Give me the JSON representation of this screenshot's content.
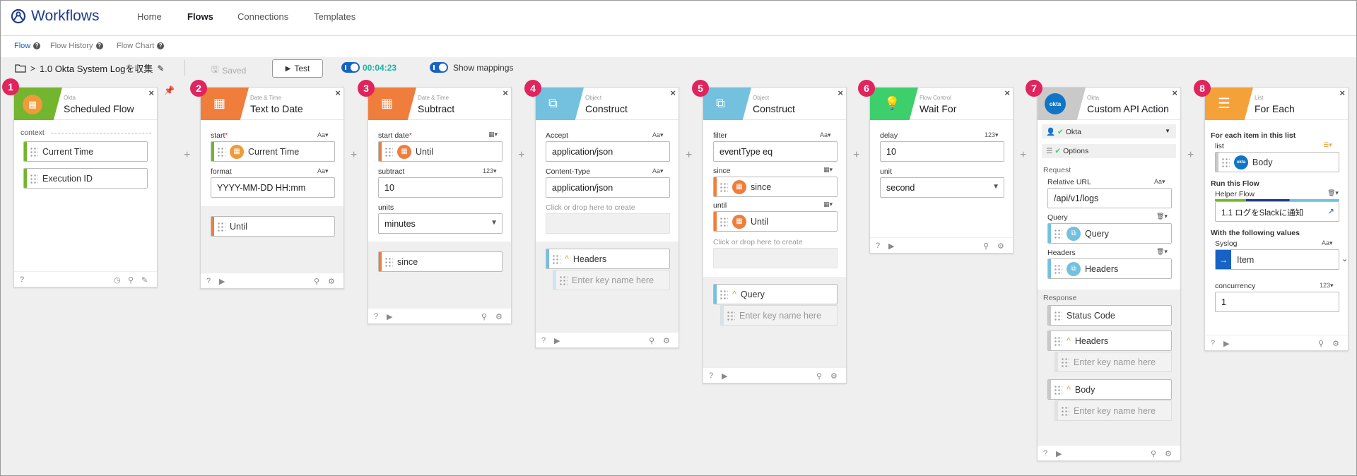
{
  "app": {
    "name": "Workflows"
  },
  "nav": {
    "home": "Home",
    "flows": "Flows",
    "connections": "Connections",
    "templates": "Templates"
  },
  "subnav": {
    "flow": "Flow",
    "history": "Flow History",
    "chart": "Flow Chart"
  },
  "toolbar": {
    "flow_name": "1.0 Okta System Logを収集",
    "saved": "Saved",
    "test": "Test",
    "timer": "00:04:23",
    "show_mappings": "Show mappings"
  },
  "cards": {
    "c1": {
      "num": "1",
      "category": "Okta",
      "title": "Scheduled Flow",
      "section": "context",
      "items": [
        "Current Time",
        "Execution ID"
      ]
    },
    "c2": {
      "num": "2",
      "category": "Date & Time",
      "title": "Text to Date",
      "start_label": "start",
      "req": "*",
      "type_text": "Aa",
      "start_value": "Current Time",
      "format_label": "format",
      "format_value": "YYYY-MM-DD HH:mm",
      "output": "Until"
    },
    "c3": {
      "num": "3",
      "category": "Date & Time",
      "title": "Subtract",
      "start_label": "start date",
      "req": "*",
      "start_value": "Until",
      "subtract_label": "subtract",
      "type_num": "123",
      "subtract_value": "10",
      "units_label": "units",
      "units_value": "minutes",
      "output": "since"
    },
    "c4": {
      "num": "4",
      "category": "Object",
      "title": "Construct",
      "accept_label": "Accept",
      "type_text": "Aa",
      "accept_value": "application/json",
      "ctype_label": "Content-Type",
      "ctype_value": "application/json",
      "hint": "Click or drop here to create",
      "output": "Headers",
      "key_placeholder": "Enter key name here"
    },
    "c5": {
      "num": "5",
      "category": "Object",
      "title": "Construct",
      "filter_label": "filter",
      "type_text": "Aa",
      "filter_value": "eventType eq",
      "since_label": "since",
      "since_value": "since",
      "until_label": "until",
      "until_value": "Until",
      "hint": "Click or drop here to create",
      "output": "Query",
      "key_placeholder": "Enter key name here"
    },
    "c6": {
      "num": "6",
      "category": "Flow Control",
      "title": "Wait For",
      "delay_label": "delay",
      "type_num": "123",
      "delay_value": "10",
      "unit_label": "unit",
      "unit_value": "second"
    },
    "c7": {
      "num": "7",
      "category": "Okta",
      "title": "Custom API Action",
      "logo": "okta",
      "conn": "Okta",
      "options": "Options",
      "request": "Request",
      "url_label": "Relative URL",
      "type_text": "Aa",
      "url_value": "/api/v1/logs",
      "query_label": "Query",
      "query_value": "Query",
      "headers_label": "Headers",
      "headers_value": "Headers",
      "response": "Response",
      "status": "Status Code",
      "resp_headers": "Headers",
      "key_placeholder": "Enter key name here",
      "body": "Body"
    },
    "c8": {
      "num": "8",
      "category": "List",
      "title": "For Each",
      "each_label": "For each item in this list",
      "list_label": "list",
      "list_value": "Body",
      "logo": "okta",
      "run_label": "Run this Flow",
      "helper_label": "Helper Flow",
      "helper_value": "1.1 ログをSlackに通知",
      "with_label": "With the following values",
      "syslog_label": "Syslog",
      "type_text": "Aa",
      "syslog_value": "Item",
      "conc_label": "concurrency",
      "type_num": "123",
      "conc_value": "1"
    }
  },
  "colors": {
    "okta": "#73b52e",
    "datetime": "#ef7d3b",
    "object": "#73c0df",
    "flow": "#3ecf6d",
    "okta_action": "#c9c9c9",
    "list": "#f4a13a",
    "badge": "#e0245e",
    "accent": "#1862c6"
  }
}
